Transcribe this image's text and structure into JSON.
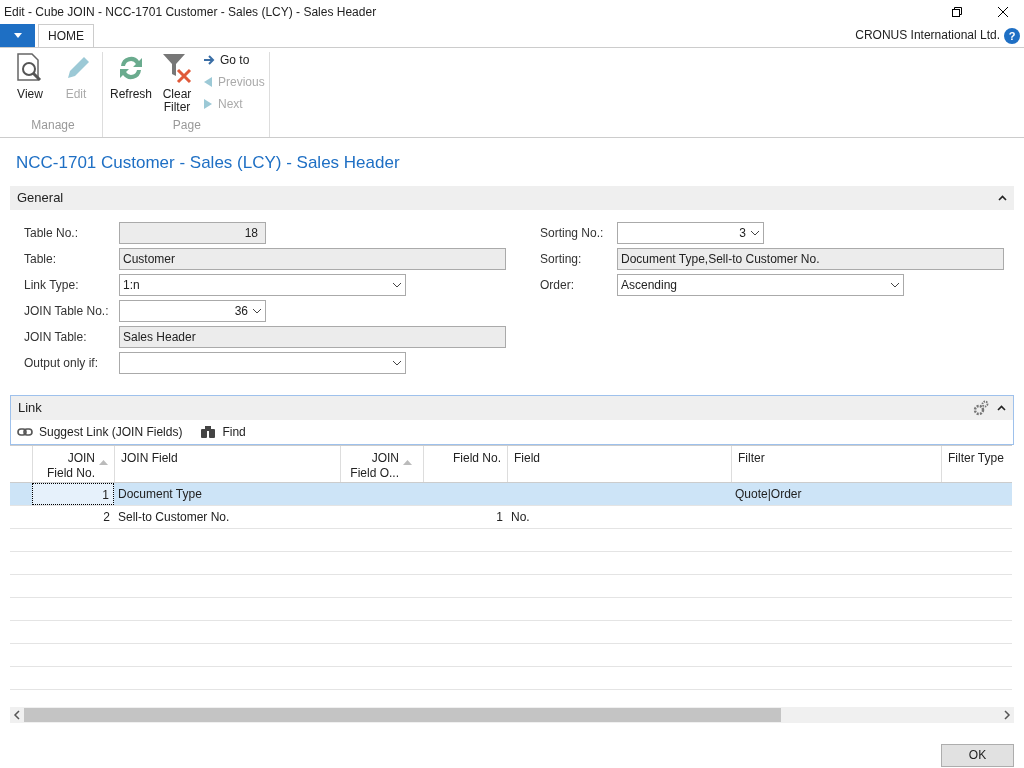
{
  "window": {
    "title": "Edit - Cube JOIN - NCC-1701 Customer - Sales (LCY) - Sales Header"
  },
  "tabs": [
    {
      "label": "HOME",
      "selected": true
    }
  ],
  "company": "CRONUS International Ltd.",
  "help": "?",
  "ribbon": {
    "groups": [
      {
        "label": "Manage",
        "actions": [
          {
            "kind": "large",
            "label": "View",
            "disabled": false
          },
          {
            "kind": "large",
            "label": "Edit",
            "disabled": true
          }
        ]
      },
      {
        "label": "Page",
        "actions": [
          {
            "kind": "large",
            "label": "Refresh",
            "disabled": false
          },
          {
            "kind": "large",
            "label": "Clear Filter",
            "disabled": false
          },
          {
            "kind": "small",
            "label": "Go to",
            "disabled": false
          },
          {
            "kind": "small",
            "label": "Previous",
            "disabled": true
          },
          {
            "kind": "small",
            "label": "Next",
            "disabled": true
          }
        ]
      }
    ]
  },
  "page_title": "NCC-1701 Customer - Sales (LCY) - Sales Header",
  "general": {
    "title": "General",
    "expanded": true,
    "left": [
      {
        "label": "Table No.:",
        "kind": "readonly-number",
        "value": "18"
      },
      {
        "label": "Table:",
        "kind": "readonly",
        "value": "Customer"
      },
      {
        "label": "Link Type:",
        "kind": "select",
        "value": "1:n"
      },
      {
        "label": "JOIN Table No.:",
        "kind": "select-number",
        "value": "36"
      },
      {
        "label": "JOIN Table:",
        "kind": "readonly",
        "value": "Sales Header"
      },
      {
        "label": "Output only if:",
        "kind": "select"
      }
    ],
    "right": [
      {
        "label": "Sorting No.:",
        "kind": "select-number",
        "value": "3"
      },
      {
        "label": "Sorting:",
        "kind": "readonly",
        "value": "Document Type,Sell-to Customer No."
      },
      {
        "label": "Order:",
        "kind": "select",
        "value": "Ascending"
      }
    ]
  },
  "link": {
    "title": "Link",
    "expanded": true,
    "actions": [
      {
        "label": "Suggest Link (JOIN Fields)"
      },
      {
        "label": "Find"
      }
    ],
    "columns": [
      {
        "label": "JOIN Field No.",
        "sorted": true
      },
      {
        "label": "JOIN Field",
        "sorted": false
      },
      {
        "label": "JOIN Field O...",
        "sorted": true
      },
      {
        "label": "Field No.",
        "sorted": false
      },
      {
        "label": "Field",
        "sorted": false
      },
      {
        "label": "Filter",
        "sorted": false
      },
      {
        "label": "Filter Type",
        "sorted": false
      }
    ],
    "rows": [
      {
        "selected": true,
        "cells": [
          "1",
          "Document Type",
          "",
          "",
          "",
          "Quote|Order",
          ""
        ]
      },
      {
        "selected": false,
        "cells": [
          "2",
          "Sell-to Customer No.",
          "",
          "1",
          "No.",
          "",
          ""
        ]
      }
    ]
  },
  "buttons": [
    "OK"
  ]
}
